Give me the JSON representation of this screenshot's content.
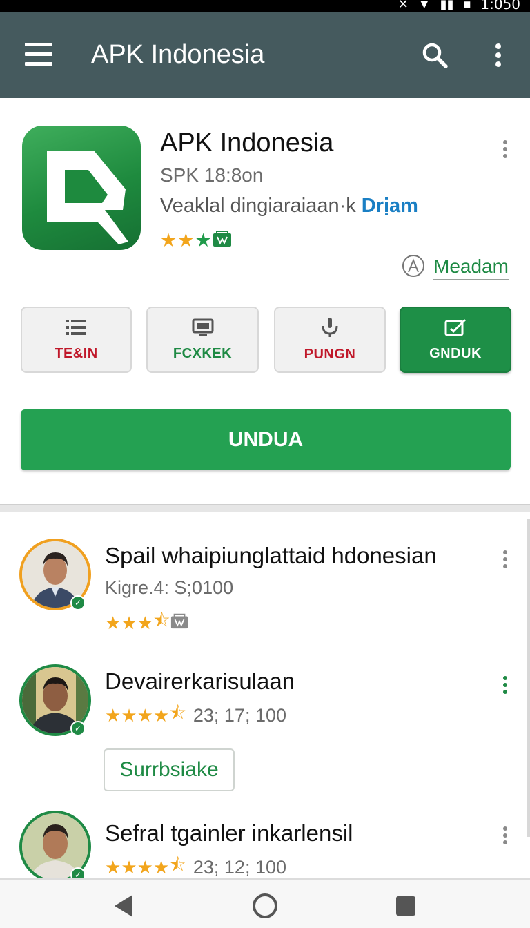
{
  "status_bar": {
    "time": "1:050"
  },
  "app_bar": {
    "title": "APK Indonesia"
  },
  "app": {
    "name": "APK Indonesia",
    "version": "SPK 18:8on",
    "description": "Veaklal dingiaraiaan·k",
    "description_link": "Drịam",
    "rating_stars": [
      "full",
      "full",
      "full-green",
      "badge"
    ],
    "meadam_label": "Meadam"
  },
  "actions": [
    {
      "label": "TE&IN",
      "icon": "list-icon",
      "color": "#c0182a"
    },
    {
      "label": "FCXKEK",
      "icon": "tv-icon",
      "color": "#1e8a44"
    },
    {
      "label": "PUNGN",
      "icon": "microphone-icon",
      "color": "#c0182a"
    },
    {
      "label": "GNDUK",
      "icon": "edit-icon",
      "color": "#ffffff"
    }
  ],
  "download_label": "UNDUA",
  "reviews": [
    {
      "title": "Spail whaipiunglattaid hdonesian",
      "subtitle": "Kigre.4: S;0100",
      "stars": 3.5,
      "count": "",
      "avatar_ring": "orange"
    },
    {
      "title": "Devairerkarisulaan",
      "subtitle": "",
      "stars": 4.5,
      "count": "23; 17; 100",
      "avatar_ring": "green",
      "button": "Surrbsiake"
    },
    {
      "title": "Sefral tgainler inkarlensil",
      "subtitle": "",
      "stars": 4.5,
      "count": "23; 12; 100",
      "avatar_ring": "green"
    }
  ],
  "colors": {
    "app_bar": "#455a5e",
    "primary_green": "#24a152",
    "accent_orange": "#f2a51c"
  }
}
